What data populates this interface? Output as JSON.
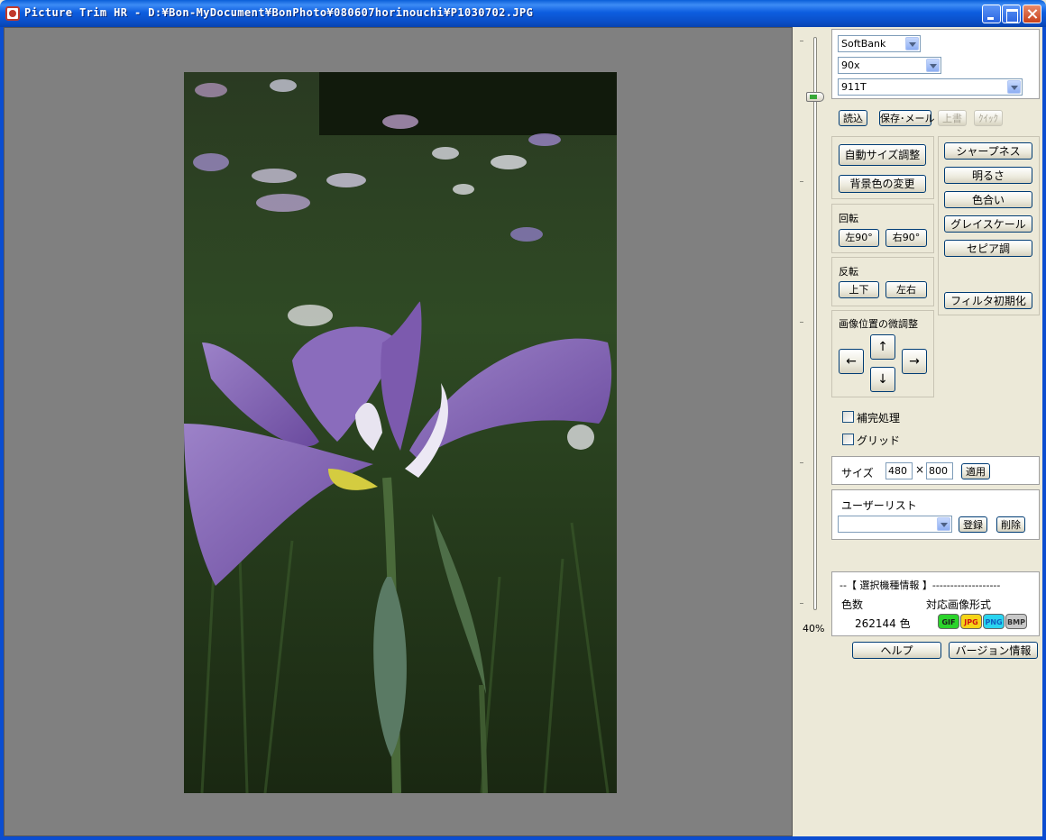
{
  "window": {
    "title": "Picture Trim HR - D:¥Bon-MyDocument¥BonPhoto¥080607horinouchi¥P1030702.JPG"
  },
  "zoom": {
    "label": "40%",
    "level": 0.4
  },
  "device": {
    "carrier": "SoftBank",
    "series": "90x",
    "model": "911T"
  },
  "file_buttons": {
    "load": "読込",
    "save_mail": "保存･メール",
    "overwrite": "上書",
    "quick": "ｸｲｯｸ"
  },
  "adjust": {
    "auto_size": "自動サイズ調整",
    "bg_color": "背景色の変更"
  },
  "rotate": {
    "title": "回転",
    "left": "左90°",
    "right": "右90°"
  },
  "flip": {
    "title": "反転",
    "vertical": "上下",
    "horizontal": "左右"
  },
  "position": {
    "title": "画像位置の微調整",
    "up": "↑",
    "down": "↓",
    "left": "←",
    "right": "→"
  },
  "filters": {
    "sharpness": "シャープネス",
    "brightness": "明るさ",
    "hue": "色合い",
    "grayscale": "グレイスケール",
    "sepia": "セピア調",
    "reset": "フィルタ初期化"
  },
  "options": {
    "interpolate": "補完処理",
    "grid": "グリッド"
  },
  "size": {
    "label": "サイズ",
    "width": "480",
    "times": "×",
    "height": "800",
    "apply": "適用"
  },
  "userlist": {
    "title": "ユーザーリスト",
    "selected": "",
    "register": "登録",
    "delete": "削除"
  },
  "info": {
    "header": "--【 選択機種情報 】-------------------",
    "colors_label": "色数",
    "formats_label": "対応画像形式",
    "colors_value": "262144 色",
    "formats": [
      "GIF",
      "JPG",
      "PNG",
      "BMP"
    ]
  },
  "bottom": {
    "help": "ヘルプ",
    "version": "バージョン情報"
  },
  "colors": {
    "titlebar": "#0a54d6",
    "canvas": "#808080",
    "panel": "#ece9d8",
    "gif": "#2bd42b",
    "jpg": "#f5d418",
    "png": "#2ad4f0",
    "bmp": "#c8c8c8"
  }
}
